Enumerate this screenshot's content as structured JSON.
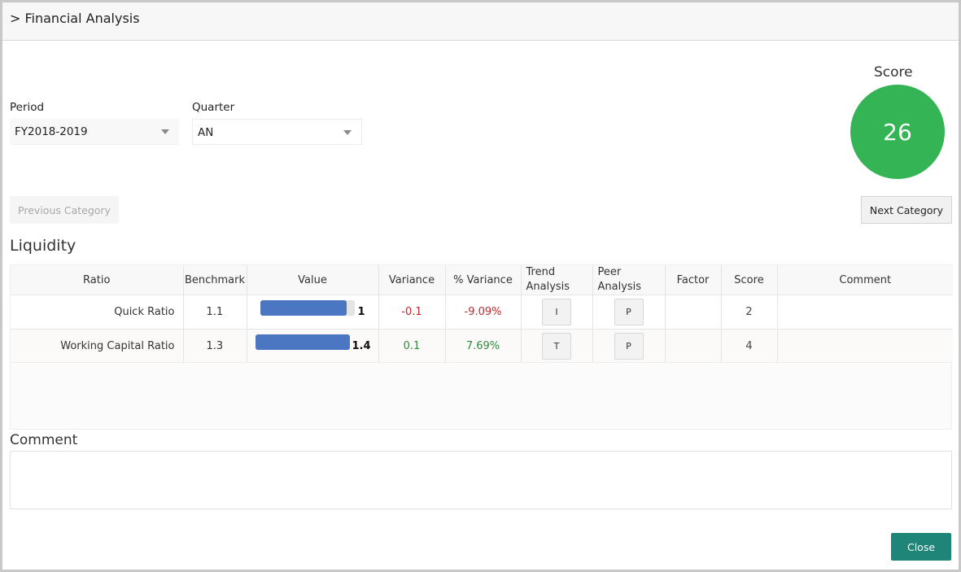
{
  "header": {
    "title": "> Financial Analysis"
  },
  "filters": {
    "period_label": "Period",
    "period_value": "FY2018-2019",
    "quarter_label": "Quarter",
    "quarter_value": "AN"
  },
  "score": {
    "label": "Score",
    "value": "26",
    "color": "#34b454"
  },
  "nav": {
    "previous_label": "Previous Category",
    "next_label": "Next Category"
  },
  "category": "Liquidity",
  "table": {
    "headers": {
      "ratio": "Ratio",
      "benchmark": "Benchmark",
      "value": "Value",
      "variance": "Variance",
      "pct_variance": "% Variance",
      "trend_1": "Trend",
      "trend_2": "Analysis",
      "peer_1": "Peer",
      "peer_2": "Analysis",
      "factor": "Factor",
      "score": "Score",
      "comment": "Comment"
    },
    "rows": [
      {
        "ratio": "Quick Ratio",
        "benchmark": "1.1",
        "value": "1",
        "value_fill": 0.92,
        "variance": "-0.1",
        "pct_variance": "-9.09%",
        "trend_btn": "I",
        "peer_btn": "P",
        "factor": "",
        "score": "2",
        "comment": ""
      },
      {
        "ratio": "Working Capital Ratio",
        "benchmark": "1.3",
        "value": "1.4",
        "value_fill": 1.0,
        "variance": "0.1",
        "pct_variance": "7.69%",
        "trend_btn": "T",
        "peer_btn": "P",
        "factor": "",
        "score": "4",
        "comment": ""
      }
    ]
  },
  "comment": {
    "label": "Comment",
    "value": ""
  },
  "close_label": "Close",
  "colors": {
    "close_button": "#1e8578",
    "bar": "#4a76c2",
    "negative": "#c0282d",
    "positive": "#2e8b3d"
  }
}
